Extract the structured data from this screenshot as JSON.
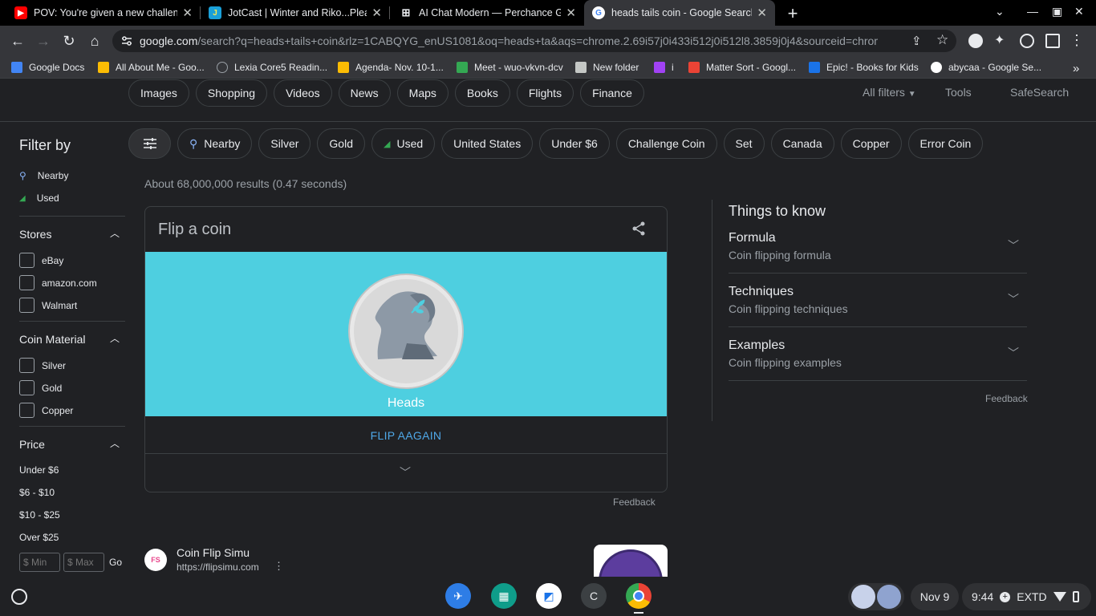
{
  "tabs": [
    {
      "title": "POV: You're given a new challeng",
      "favicon": "youtube-icon",
      "color": "#ff0000"
    },
    {
      "title": "JotCast | Winter and Riko...Pleas",
      "favicon": "jotcast-icon",
      "color": "#1aa0d8"
    },
    {
      "title": "AI Chat Modern — Perchance Ge",
      "favicon": "perchance-icon",
      "color": "#e8eaed"
    },
    {
      "title": "heads tails coin - Google Search",
      "favicon": "google-icon",
      "color": "#4285f4"
    }
  ],
  "window": {
    "new_tab": "+",
    "dropdown": "⌄",
    "minimize": "—",
    "maximize": "▣",
    "close": "✕"
  },
  "toolbar": {
    "back": "←",
    "forward": "→",
    "reload": "↻",
    "home": "⌂",
    "url_domain": "google.com",
    "url_path": "/search?q=heads+tails+coin&rlz=1CABQYG_enUS1081&oq=heads+ta&aqs=chrome.2.69i57j0i433i512j0i512l8.3859j0j4&sourceid=chrome...",
    "share": "⇪",
    "star": "☆",
    "more": "⋮"
  },
  "bookmarks": [
    {
      "label": "Google Docs",
      "color": "#4285f4"
    },
    {
      "label": "All About Me - Goo...",
      "color": "#fbbc04"
    },
    {
      "label": "Lexia Core5 Readin...",
      "color": "#9aa0a6"
    },
    {
      "label": "Agenda- Nov. 10-1...",
      "color": "#fbbc04"
    },
    {
      "label": "Meet - wuo-vkvn-dcv",
      "color": "#34a853"
    },
    {
      "label": "New folder",
      "color": "#c4c7c5"
    },
    {
      "label": "i",
      "color": "#a142f4"
    },
    {
      "label": "Matter Sort - Googl...",
      "color": "#ea4335"
    },
    {
      "label": "Epic! - Books for Kids",
      "color": "#1a73e8"
    },
    {
      "label": "abycaa - Google Se...",
      "color": "#e8eaed"
    }
  ],
  "bookmarks_more": "»",
  "vertical_tabs": [
    "Images",
    "Shopping",
    "Videos",
    "News",
    "Maps",
    "Books",
    "Flights",
    "Finance"
  ],
  "right_tools": {
    "all_filters": "All filters",
    "tools": "Tools",
    "safesearch": "SafeSearch"
  },
  "filter": {
    "title": "Filter by",
    "quick": [
      "Nearby",
      "Used"
    ],
    "stores": {
      "title": "Stores",
      "items": [
        "eBay",
        "amazon.com",
        "Walmart"
      ]
    },
    "material": {
      "title": "Coin Material",
      "items": [
        "Silver",
        "Gold",
        "Copper"
      ]
    },
    "price": {
      "title": "Price",
      "items": [
        "Under $6",
        "$6 - $10",
        "$10 - $25",
        "Over $25"
      ],
      "min_placeholder": "$ Min",
      "max_placeholder": "$ Max",
      "go": "Go"
    }
  },
  "chips": [
    "Nearby",
    "Silver",
    "Gold",
    "Used",
    "United States",
    "Under $6",
    "Challenge Coin",
    "Set",
    "Canada",
    "Copper",
    "Error Coin"
  ],
  "results_stats": "About 68,000,000 results (0.47 seconds)",
  "coin_card": {
    "title": "Flip a coin",
    "result": "Heads",
    "flip_again": "FLIP AAGAIN",
    "bg": "#4ecfe0"
  },
  "feedback": "Feedback",
  "things_to_know": {
    "title": "Things to know",
    "items": [
      {
        "title": "Formula",
        "subtitle": "Coin flipping formula"
      },
      {
        "title": "Techniques",
        "subtitle": "Coin flipping techniques"
      },
      {
        "title": "Examples",
        "subtitle": "Coin flipping examples"
      }
    ]
  },
  "result2": {
    "title": "Coin Flip Simu",
    "url": "https://flipsimu.com",
    "favicon": "FS"
  },
  "shelf": {
    "date": "Nov 9",
    "time": "9:44",
    "extd": "EXTD",
    "launcher_letter": "C"
  }
}
